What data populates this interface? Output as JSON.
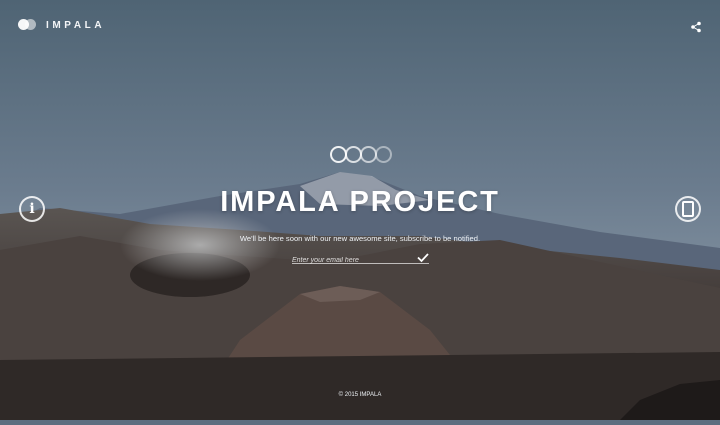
{
  "brand": {
    "name": "IMPALA"
  },
  "hero": {
    "title": "IMPALA PROJECT",
    "subtitle": "We'll be here soon with our new awesome site, subscribe to be notified."
  },
  "subscribe": {
    "email_placeholder": "Enter your email here",
    "submit_icon": "checkmark-icon"
  },
  "icons": {
    "share": "share-icon",
    "info": "info-icon",
    "mobile": "mobile-icon"
  },
  "footer": {
    "copyright": "© 2015 IMPALA"
  },
  "colors": {
    "sky_top": "#4f6474",
    "sky_bottom": "#7a8a9a",
    "ground": "#3b3331",
    "accent": "#ffffff"
  }
}
